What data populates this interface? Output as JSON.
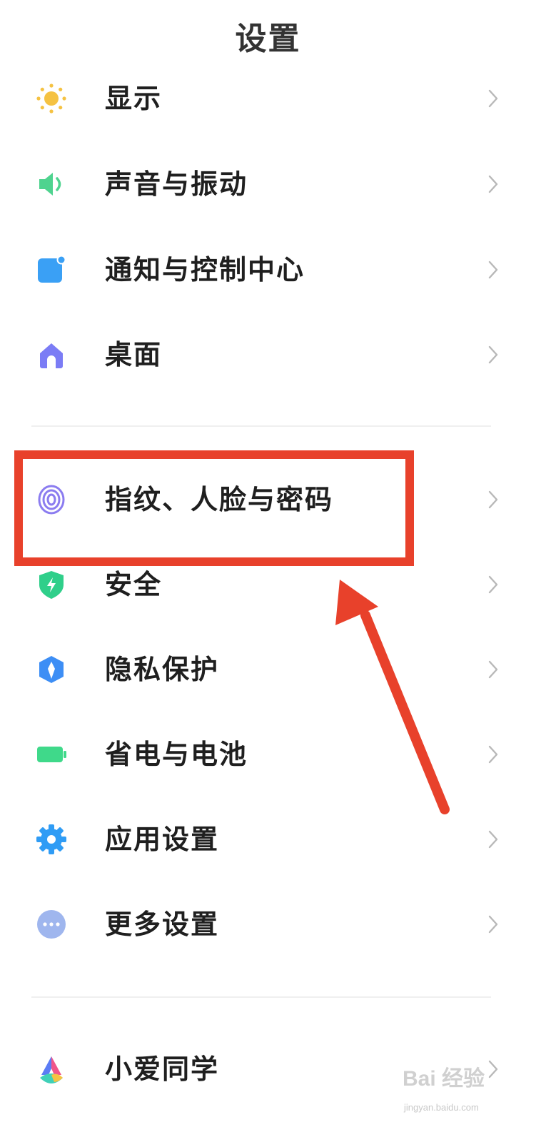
{
  "header": {
    "title": "设置"
  },
  "settings": {
    "group1": [
      {
        "label": "显示",
        "icon": "sun-icon"
      },
      {
        "label": "声音与振动",
        "icon": "speaker-icon"
      },
      {
        "label": "通知与控制中心",
        "icon": "notification-icon"
      },
      {
        "label": "桌面",
        "icon": "home-icon"
      }
    ],
    "group2": [
      {
        "label": "指纹、人脸与密码",
        "icon": "fingerprint-icon"
      },
      {
        "label": "安全",
        "icon": "shield-icon"
      },
      {
        "label": "隐私保护",
        "icon": "privacy-icon"
      },
      {
        "label": "省电与电池",
        "icon": "battery-icon"
      },
      {
        "label": "应用设置",
        "icon": "gear-icon"
      },
      {
        "label": "更多设置",
        "icon": "more-icon"
      }
    ],
    "group3": [
      {
        "label": "小爱同学",
        "icon": "xiaoai-icon"
      }
    ]
  },
  "annotation": {
    "highlight_color": "#e8412b",
    "target": "指纹、人脸与密码"
  },
  "watermark": {
    "brand": "Bai 经验",
    "site": "jingyan.baidu.com"
  },
  "colors": {
    "sun": "#f5c242",
    "speaker": "#4fd38f",
    "notification": "#3aa0f5",
    "home": "#7b7cf5",
    "fingerprint": "#8b7cf0",
    "shield": "#2fcf8a",
    "privacy": "#3d8ef5",
    "battery": "#3fd98a",
    "gear": "#2f9cf5",
    "more": "#9fb6ee"
  }
}
